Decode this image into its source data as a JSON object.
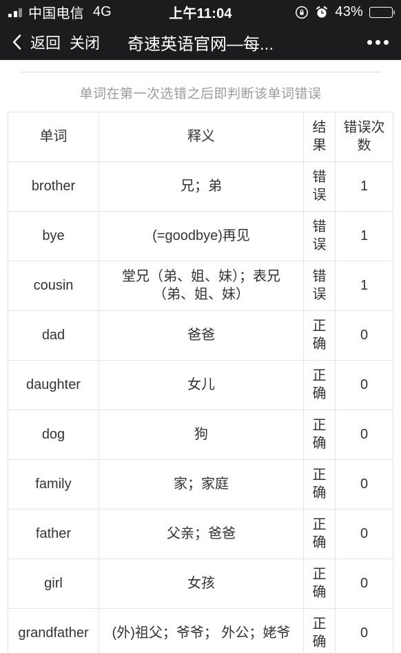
{
  "status_bar": {
    "signal_icon": "signal-bars-icon",
    "carrier": "中国电信",
    "network": "4G",
    "time": "上午11:04",
    "rotation_lock_icon": "rotation-lock-icon",
    "alarm_icon": "alarm-clock-icon",
    "battery_percent": "43%",
    "battery_icon": "battery-icon",
    "battery_level": 43
  },
  "nav_bar": {
    "back_icon": "chevron-left-icon",
    "back_label": "返回",
    "close_label": "关闭",
    "title": "奇速英语官网—每...",
    "more_icon": "more-dots-icon"
  },
  "page": {
    "subtitle": "单词在第一次选错之后即判断该单词错误"
  },
  "table": {
    "headers": {
      "word": "单词",
      "definition": "释义",
      "result": "结果",
      "error_count": "错误次数"
    },
    "rows": [
      {
        "word": "brother",
        "definition": "兄；弟",
        "result": "错误",
        "result_type": "wrong",
        "error_count": "1"
      },
      {
        "word": "bye",
        "definition": "(=goodbye)再见",
        "result": "错误",
        "result_type": "wrong",
        "error_count": "1"
      },
      {
        "word": "cousin",
        "definition": "堂兄（弟、姐、妹）；表兄（弟、姐、妹）",
        "result": "错误",
        "result_type": "wrong",
        "error_count": "1"
      },
      {
        "word": "dad",
        "definition": "爸爸",
        "result": "正确",
        "result_type": "right",
        "error_count": "0"
      },
      {
        "word": "daughter",
        "definition": "女儿",
        "result": "正确",
        "result_type": "right",
        "error_count": "0"
      },
      {
        "word": "dog",
        "definition": "狗",
        "result": "正确",
        "result_type": "right",
        "error_count": "0"
      },
      {
        "word": "family",
        "definition": "家；家庭",
        "result": "正确",
        "result_type": "right",
        "error_count": "0"
      },
      {
        "word": "father",
        "definition": "父亲；爸爸",
        "result": "正确",
        "result_type": "right",
        "error_count": "0"
      },
      {
        "word": "girl",
        "definition": "女孩",
        "result": "正确",
        "result_type": "right",
        "error_count": "0"
      },
      {
        "word": "grandfather",
        "definition": "(外)祖父；爷爷； 外公；姥爷",
        "result": "正确",
        "result_type": "right",
        "error_count": "0"
      }
    ]
  },
  "colors": {
    "status_bar_bg": "#1c1c1e",
    "wrong": "#e0402e",
    "right": "#3b9e4d",
    "border": "#e4e4e4",
    "subtitle": "#9b9b9b"
  }
}
